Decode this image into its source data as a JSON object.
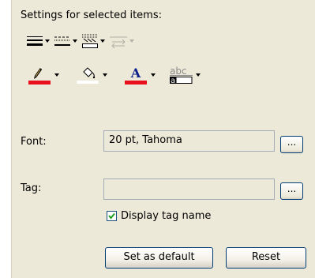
{
  "heading": "Settings for selected items:",
  "toolbar": {
    "row1": [
      {
        "icon": "line-style-solid-icon",
        "enabled": true
      },
      {
        "icon": "line-style-dashed-icon",
        "enabled": true
      },
      {
        "icon": "border-style-icon",
        "enabled": true
      },
      {
        "icon": "line-spacing-arrows-icon",
        "enabled": false
      }
    ],
    "row2": [
      {
        "icon": "line-color-pen-icon",
        "color": "#e8101c"
      },
      {
        "icon": "fill-color-bucket-icon",
        "color": "#ffffff"
      },
      {
        "icon": "font-color-icon",
        "glyph": "A",
        "color": "#e8101c"
      },
      {
        "icon": "text-highlight-icon",
        "glyph": "abc",
        "sample": "a"
      }
    ]
  },
  "font": {
    "label": "Font:",
    "value": "20 pt, Tahoma",
    "browse": "..."
  },
  "tag": {
    "label": "Tag:",
    "value": "",
    "browse": "...",
    "display_tag_name": {
      "label": "Display tag name",
      "checked": true
    }
  },
  "buttons": {
    "set_default": "Set as default",
    "reset": "Reset"
  }
}
